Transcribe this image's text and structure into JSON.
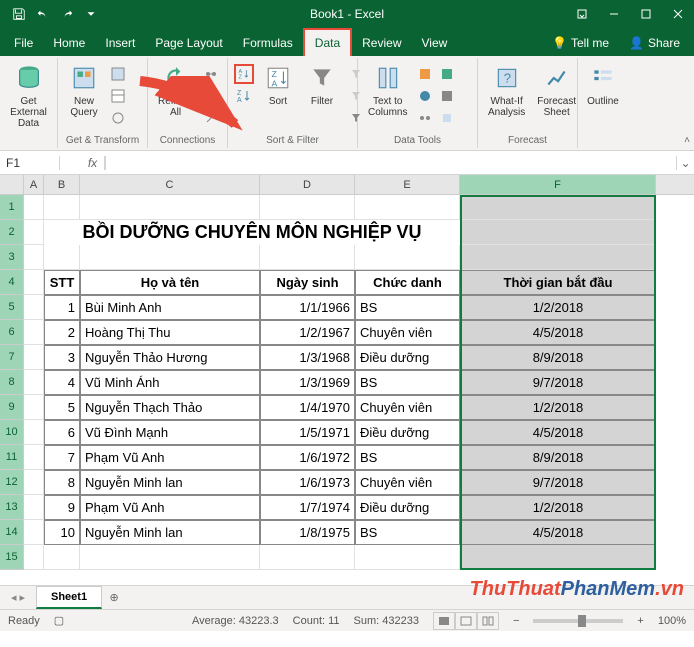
{
  "app": {
    "title": "Book1 - Excel"
  },
  "tabs": {
    "list": [
      "File",
      "Home",
      "Insert",
      "Page Layout",
      "Formulas",
      "Data",
      "Review",
      "View"
    ],
    "active": "Data",
    "tellme": "Tell me",
    "share": "Share"
  },
  "ribbon": {
    "groups": {
      "get_transform": "Get & Transform",
      "connections": "Connections",
      "sort_filter": "Sort & Filter",
      "data_tools": "Data Tools",
      "forecast": "Forecast",
      "outline": "Outline"
    },
    "buttons": {
      "get_external": "Get External\nData",
      "new_query": "New\nQuery",
      "refresh_all": "Refresh\nAll",
      "sort": "Sort",
      "filter": "Filter",
      "text_to_columns": "Text to\nColumns",
      "what_if": "What-If\nAnalysis",
      "forecast_sheet": "Forecast\nSheet",
      "outline": "Outline"
    }
  },
  "formula": {
    "name_box": "F1",
    "fx": "fx",
    "value": ""
  },
  "columns": [
    "A",
    "B",
    "C",
    "D",
    "E",
    "F"
  ],
  "table": {
    "title": "BỒI DƯỠNG CHUYÊN MÔN NGHIỆP VỤ",
    "headers": {
      "stt": "STT",
      "hoten": "Họ và tên",
      "ngaysinh": "Ngày sinh",
      "chucdanh": "Chức danh",
      "thoigian": "Thời gian bắt đầu"
    },
    "rows": [
      {
        "stt": "1",
        "hoten": "Bùi Minh Anh",
        "ngaysinh": "1/1/1966",
        "chucdanh": "BS",
        "thoigian": "1/2/2018"
      },
      {
        "stt": "2",
        "hoten": "Hoàng Thị Thu",
        "ngaysinh": "1/2/1967",
        "chucdanh": "Chuyên viên",
        "thoigian": "4/5/2018"
      },
      {
        "stt": "3",
        "hoten": "Nguyễn Thảo Hương",
        "ngaysinh": "1/3/1968",
        "chucdanh": "Điều dưỡng",
        "thoigian": "8/9/2018"
      },
      {
        "stt": "4",
        "hoten": "Vũ Minh Ánh",
        "ngaysinh": "1/3/1969",
        "chucdanh": "BS",
        "thoigian": "9/7/2018"
      },
      {
        "stt": "5",
        "hoten": "Nguyễn Thạch Thảo",
        "ngaysinh": "1/4/1970",
        "chucdanh": "Chuyên viên",
        "thoigian": "1/2/2018"
      },
      {
        "stt": "6",
        "hoten": "Vũ Đình Mạnh",
        "ngaysinh": "1/5/1971",
        "chucdanh": "Điều dưỡng",
        "thoigian": "4/5/2018"
      },
      {
        "stt": "7",
        "hoten": "Phạm Vũ Anh",
        "ngaysinh": "1/6/1972",
        "chucdanh": "BS",
        "thoigian": "8/9/2018"
      },
      {
        "stt": "8",
        "hoten": "Nguyễn Minh lan",
        "ngaysinh": "1/6/1973",
        "chucdanh": "Chuyên viên",
        "thoigian": "9/7/2018"
      },
      {
        "stt": "9",
        "hoten": "Phạm Vũ Anh",
        "ngaysinh": "1/7/1974",
        "chucdanh": "Điều dưỡng",
        "thoigian": "1/2/2018"
      },
      {
        "stt": "10",
        "hoten": "Nguyễn Minh lan",
        "ngaysinh": "1/8/1975",
        "chucdanh": "BS",
        "thoigian": "4/5/2018"
      }
    ]
  },
  "sheet_tab": "Sheet1",
  "status": {
    "ready": "Ready",
    "average": "Average: 43223.3",
    "count": "Count: 11",
    "sum": "Sum: 432233",
    "zoom": "100%"
  },
  "watermark": {
    "part1": "ThuThuat",
    "part2": "PhanMem",
    "part3": ".vn"
  }
}
